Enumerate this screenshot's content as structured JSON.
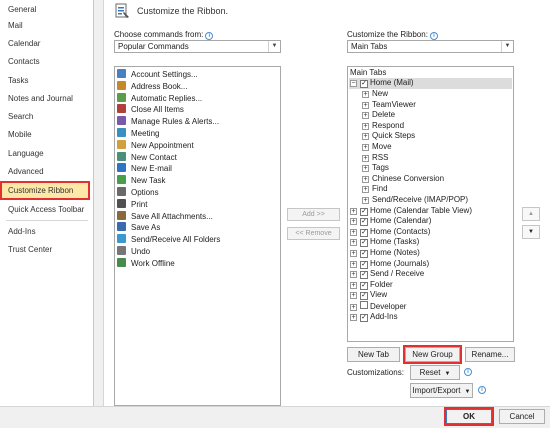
{
  "sidebar": {
    "items": [
      {
        "label": "General",
        "active": false
      },
      {
        "label": "Mail",
        "active": false
      },
      {
        "label": "Calendar",
        "active": false
      },
      {
        "label": "Contacts",
        "active": false
      },
      {
        "label": "Tasks",
        "active": false
      },
      {
        "label": "Notes and Journal",
        "active": false
      },
      {
        "label": "Search",
        "active": false
      },
      {
        "label": "Mobile",
        "active": false
      },
      {
        "label": "Language",
        "active": false
      },
      {
        "label": "Advanced",
        "active": false
      },
      {
        "label": "Customize Ribbon",
        "active": true
      },
      {
        "label": "Quick Access Toolbar",
        "active": false
      },
      {
        "label": "Add-Ins",
        "active": false
      },
      {
        "label": "Trust Center",
        "active": false
      }
    ]
  },
  "header": {
    "title": "Customize the Ribbon.",
    "icon": "ribbon-customize-icon"
  },
  "left_panel": {
    "label": "Choose commands from:",
    "label_access_key": "C",
    "dropdown_value": "Popular Commands",
    "commands": [
      {
        "label": "Account Settings...",
        "icon": "account-settings-icon"
      },
      {
        "label": "Address Book...",
        "icon": "address-book-icon"
      },
      {
        "label": "Automatic Replies...",
        "icon": "automatic-replies-icon"
      },
      {
        "label": "Close All Items",
        "icon": "close-all-icon"
      },
      {
        "label": "Manage Rules & Alerts...",
        "icon": "rules-icon"
      },
      {
        "label": "Meeting",
        "icon": "meeting-icon"
      },
      {
        "label": "New Appointment",
        "icon": "appointment-icon"
      },
      {
        "label": "New Contact",
        "icon": "contact-icon"
      },
      {
        "label": "New E-mail",
        "icon": "email-icon"
      },
      {
        "label": "New Task",
        "icon": "task-icon"
      },
      {
        "label": "Options",
        "icon": "options-icon"
      },
      {
        "label": "Print",
        "icon": "print-icon"
      },
      {
        "label": "Save All Attachments...",
        "icon": "attachment-icon"
      },
      {
        "label": "Save As",
        "icon": "save-as-icon"
      },
      {
        "label": "Send/Receive All Folders",
        "icon": "send-receive-icon"
      },
      {
        "label": "Undo",
        "icon": "undo-icon"
      },
      {
        "label": "Work Offline",
        "icon": "work-offline-icon"
      }
    ]
  },
  "middle": {
    "add_label": "Add >>",
    "remove_label": "<< Remove"
  },
  "right_panel": {
    "label": "Customize the Ribbon:",
    "label_access_key": "B",
    "dropdown_value": "Main Tabs",
    "tree_header": "Main Tabs",
    "tree": [
      {
        "label": "Home (Mail)",
        "level": 0,
        "expander": "−",
        "checked": true
      },
      {
        "label": "New",
        "level": 1
      },
      {
        "label": "TeamViewer",
        "level": 1
      },
      {
        "label": "Delete",
        "level": 1
      },
      {
        "label": "Respond",
        "level": 1
      },
      {
        "label": "Quick Steps",
        "level": 1
      },
      {
        "label": "Move",
        "level": 1
      },
      {
        "label": "RSS",
        "level": 1
      },
      {
        "label": "Tags",
        "level": 1
      },
      {
        "label": "Chinese Conversion",
        "level": 1
      },
      {
        "label": "Find",
        "level": 1
      },
      {
        "label": "Send/Receive (IMAP/POP)",
        "level": 1
      },
      {
        "label": "Home (Calendar Table View)",
        "level": 0,
        "expander": "+",
        "checked": true
      },
      {
        "label": "Home (Calendar)",
        "level": 0,
        "expander": "+",
        "checked": true
      },
      {
        "label": "Home (Contacts)",
        "level": 0,
        "expander": "+",
        "checked": true
      },
      {
        "label": "Home (Tasks)",
        "level": 0,
        "expander": "+",
        "checked": true
      },
      {
        "label": "Home (Notes)",
        "level": 0,
        "expander": "+",
        "checked": true
      },
      {
        "label": "Home (Journals)",
        "level": 0,
        "expander": "+",
        "checked": true
      },
      {
        "label": "Send / Receive",
        "level": 0,
        "expander": "+",
        "checked": true
      },
      {
        "label": "Folder",
        "level": 0,
        "expander": "+",
        "checked": true
      },
      {
        "label": "View",
        "level": 0,
        "expander": "+",
        "checked": true
      },
      {
        "label": "Developer",
        "level": 0,
        "expander": "+",
        "checked": false
      },
      {
        "label": "Add-Ins",
        "level": 0,
        "expander": "+",
        "checked": true
      }
    ],
    "move_up": "▲",
    "move_down": "▼"
  },
  "buttons": {
    "new_tab": "New Tab",
    "new_group": "New Group",
    "rename": "Rename...",
    "customizations_label": "Customizations:",
    "reset": "Reset",
    "import_export": "Import/Export"
  },
  "footer": {
    "ok": "OK",
    "cancel": "Cancel"
  },
  "colors": {
    "highlight_red": "#e03030",
    "active_bg": "#fde8a8",
    "accent_blue": "#4a8fd0"
  }
}
